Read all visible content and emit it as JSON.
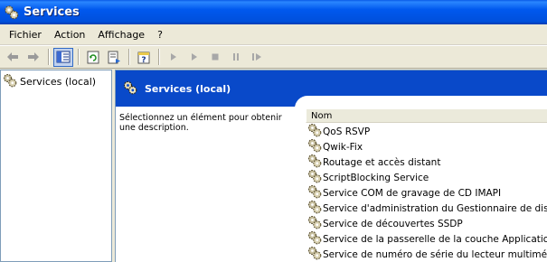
{
  "window": {
    "title": "Services",
    "icon": "services-gears-icon",
    "title_color": "#0054e3"
  },
  "menu": [
    "Fichier",
    "Action",
    "Affichage",
    "?"
  ],
  "toolbar": {
    "buttons": [
      "back-arrow-icon",
      "forward-arrow-icon",
      "show-hide-tree-icon",
      "refresh-icon",
      "export-list-icon",
      "help-properties-icon",
      "start-service-icon",
      "start-service-alt-icon",
      "stop-service-icon",
      "pause-service-icon",
      "restart-service-icon"
    ]
  },
  "tree": {
    "root_label": "Services (local)"
  },
  "pane": {
    "header_title": "Services (local)",
    "header_color": "#0949c9",
    "description": "Sélectionnez un élément pour obtenir une description."
  },
  "list": {
    "column_name": "Nom",
    "rows": [
      "QoS RSVP",
      "Qwik-Fix",
      "Routage et accès distant",
      "ScriptBlocking Service",
      "Service COM de gravage de CD IMAPI",
      "Service d'administration du Gestionnaire de disq...",
      "Service de découvertes SSDP",
      "Service de la passerelle de la couche Application",
      "Service de numéro de série du lecteur multimédi..."
    ]
  }
}
